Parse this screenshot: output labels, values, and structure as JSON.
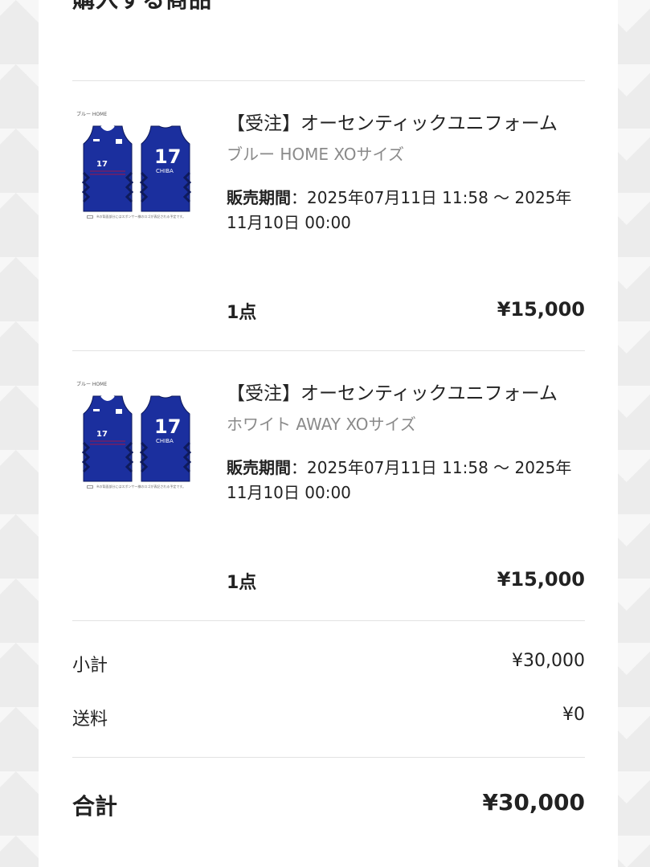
{
  "section": {
    "title": "購入する商品"
  },
  "items": [
    {
      "image_caption": "ブルー HOME",
      "image_note": "※の背面部分にはスポンサー様のロゴが表記される予定です。",
      "jersey_number": "17",
      "jersey_team_text": "CHIBA",
      "name": "【受注】オーセンティックユニフォーム",
      "variant": "ブルー HOME XOサイズ",
      "period_label": "販売期間",
      "period_sep": "：",
      "period_value": "2025年07月11日 11:58 〜 2025年11月10日 00:00",
      "quantity": "1点",
      "price": "¥15,000"
    },
    {
      "image_caption": "ブルー HOME",
      "image_note": "※の背面部分にはスポンサー様のロゴが表記される予定です。",
      "jersey_number": "17",
      "jersey_team_text": "CHIBA",
      "name": "【受注】オーセンティックユニフォーム",
      "variant": "ホワイト AWAY XOサイズ",
      "period_label": "販売期間",
      "period_sep": "：",
      "period_value": "2025年07月11日 11:58 〜 2025年11月10日 00:00",
      "quantity": "1点",
      "price": "¥15,000"
    }
  ],
  "summary": {
    "subtotal_label": "小計",
    "subtotal_value": "¥30,000",
    "shipping_label": "送料",
    "shipping_value": "¥0",
    "total_label": "合計",
    "total_value": "¥30,000"
  },
  "colors": {
    "jersey_blue": "#1b2f9e",
    "jersey_dark": "#0e1a5c",
    "accent_red": "#c8102e"
  }
}
